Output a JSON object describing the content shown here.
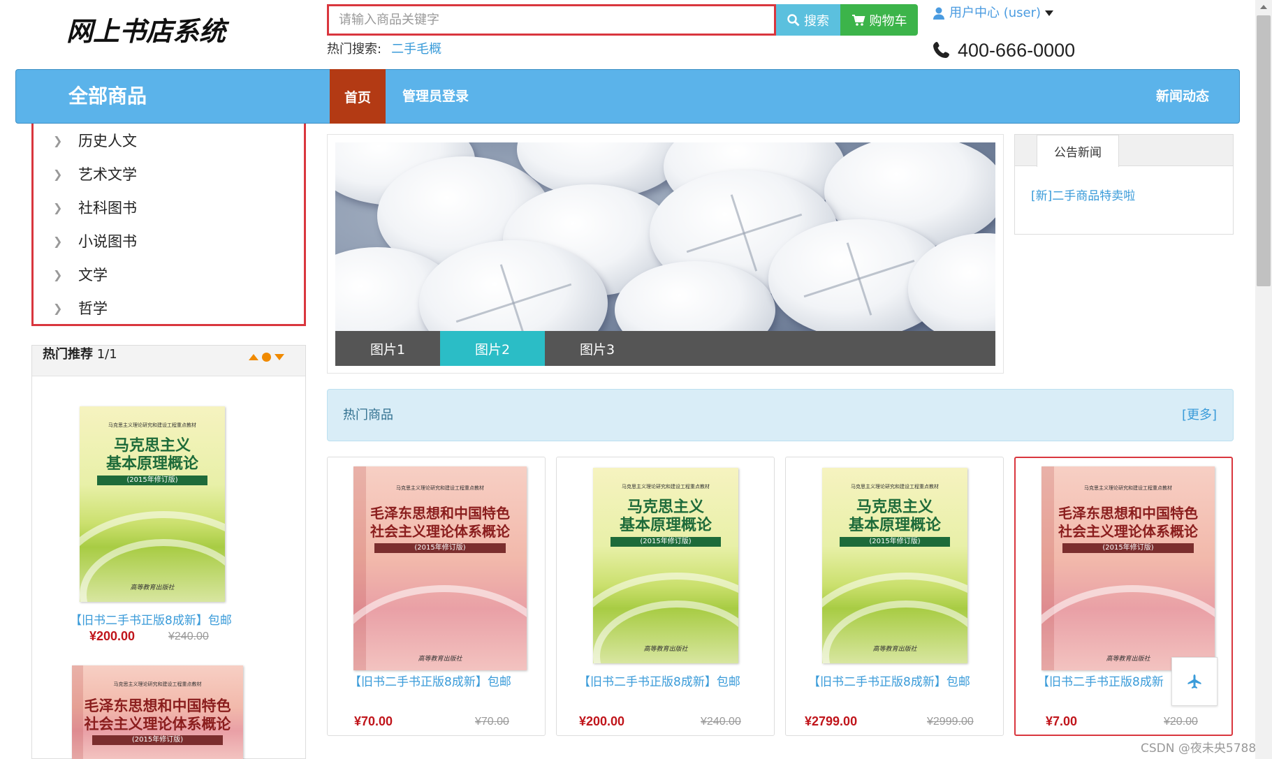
{
  "header": {
    "logo_text": "网上书店系统",
    "search_placeholder": "请输入商品关键字",
    "search_button": "搜索",
    "cart_button": "购物车",
    "hot_search_label": "热门搜索:",
    "hot_search_keyword": "二手毛概",
    "user_center": "用户中心 (user)",
    "phone": "400-666-0000"
  },
  "nav": {
    "all_goods": "全部商品",
    "home": "首页",
    "admin_login": "管理员登录",
    "news": "新闻动态"
  },
  "categories": [
    "历史人文",
    "艺术文学",
    "社科图书",
    "小说图书",
    "文学",
    "哲学"
  ],
  "recommend": {
    "title": "热门推荐",
    "page": "1/1",
    "items": [
      {
        "name": "【旧书二手书正版8成新】包邮",
        "price": "¥200.00",
        "old_price": "¥240.00",
        "cover": "mk"
      }
    ]
  },
  "carousel": {
    "tabs": [
      "图片1",
      "图片2",
      "图片3"
    ],
    "active": 1
  },
  "notice": {
    "tab": "公告新闻",
    "items": [
      "[新]二手商品特卖啦"
    ]
  },
  "hot_goods": {
    "title": "热门商品",
    "more": "[更多]",
    "items": [
      {
        "name": "【旧书二手书正版8成新】包邮",
        "price": "¥70.00",
        "old_price": "¥70.00",
        "cover": "mao"
      },
      {
        "name": "【旧书二手书正版8成新】包邮",
        "price": "¥200.00",
        "old_price": "¥240.00",
        "cover": "mk"
      },
      {
        "name": "【旧书二手书正版8成新】包邮",
        "price": "¥2799.00",
        "old_price": "¥2999.00",
        "cover": "mk"
      },
      {
        "name": "【旧书二手书正版8成新",
        "price": "¥7.00",
        "old_price": "¥20.00",
        "cover": "mao"
      }
    ]
  },
  "covers": {
    "mk": {
      "subtitle": "马克思主义理论研究和建设工程重点教材",
      "title_line1": "马克思主义",
      "title_line2": "基本原理概论",
      "edition": "(2015年修订版)",
      "publisher": "高等教育出版社"
    },
    "mao": {
      "subtitle": "马克思主义理论研究和建设工程重点教材",
      "title_line1": "毛泽东思想和中国特色",
      "title_line2": "社会主义理论体系概论",
      "edition": "(2015年修订版)",
      "publisher": "高等教育出版社"
    }
  },
  "watermark": "CSDN @夜未央5788",
  "colors": {
    "nav_blue": "#5bb3ea",
    "home_red": "#b33a14",
    "accent_red": "#d9363e",
    "link_blue": "#3a9bd9",
    "price_red": "#c0151b"
  }
}
